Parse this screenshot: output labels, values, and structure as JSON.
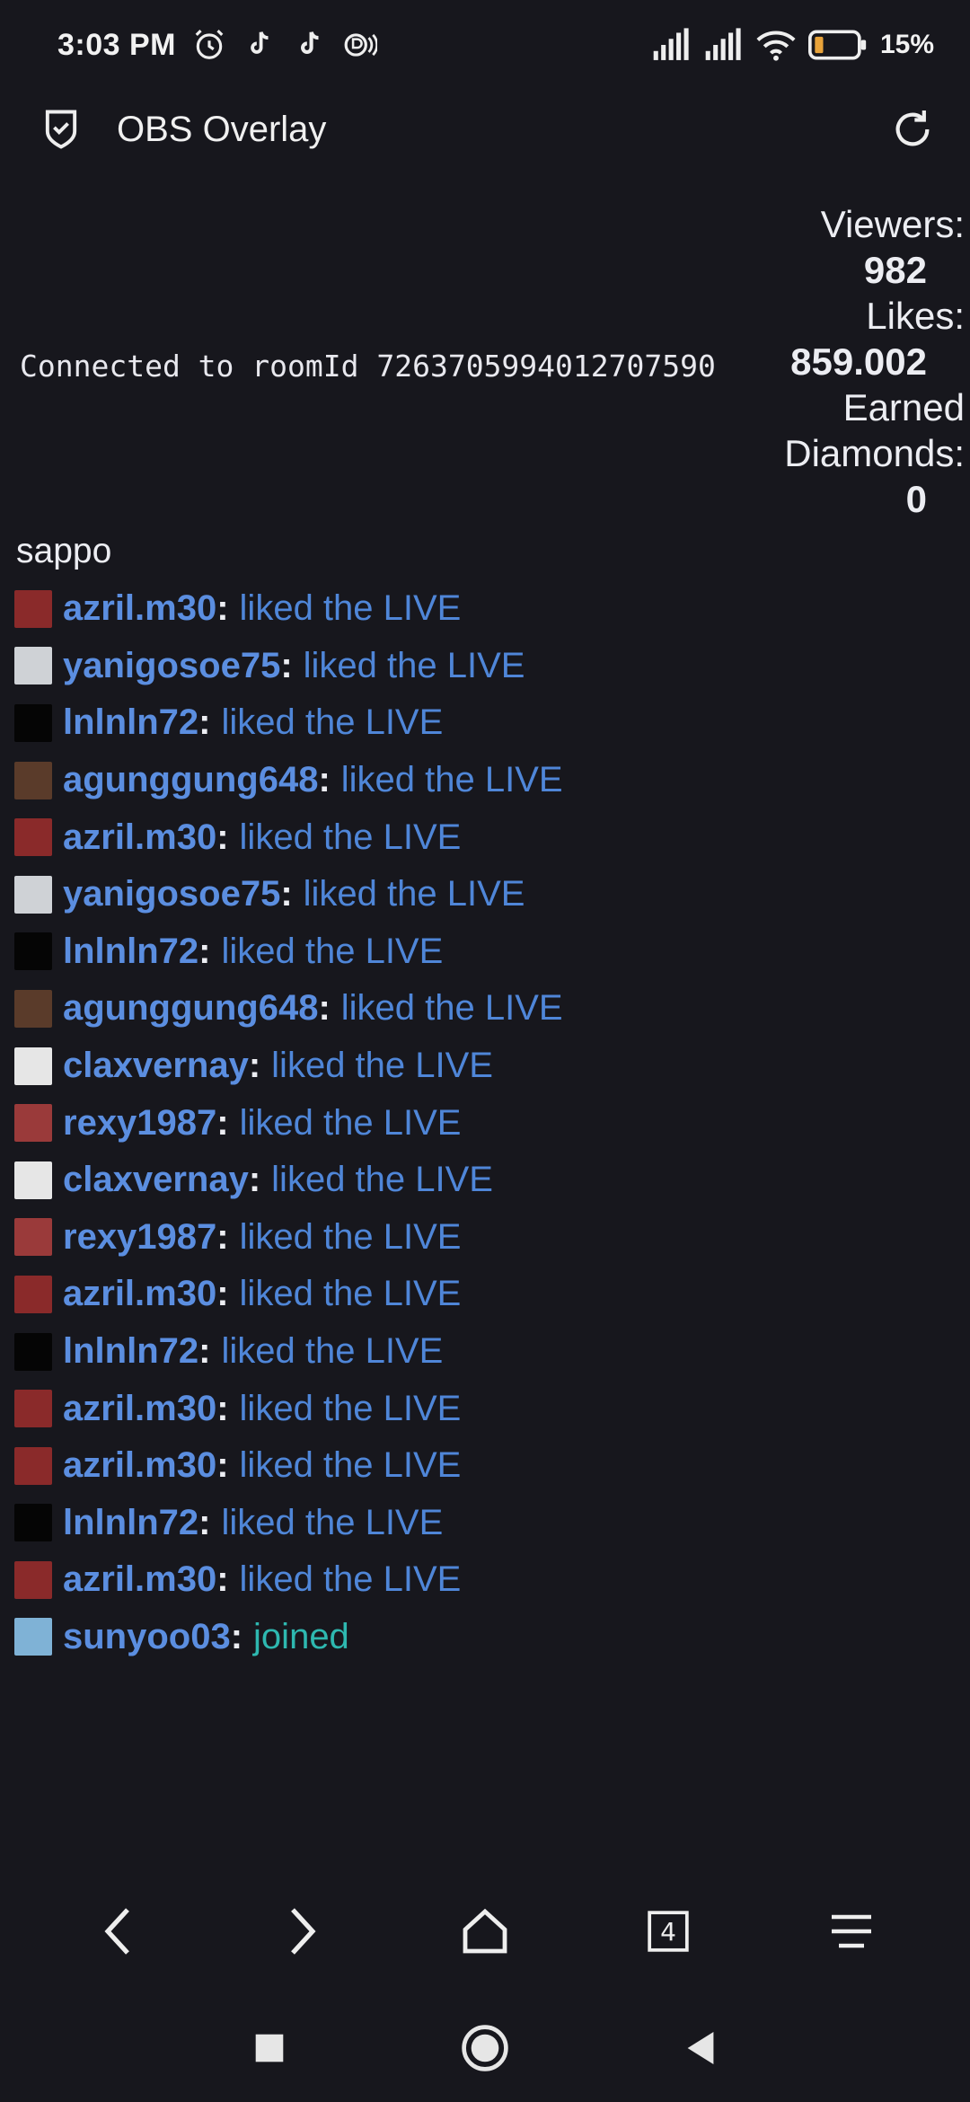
{
  "status_bar": {
    "time": "3:03 PM",
    "battery_percent": "15%",
    "icons": [
      "alarm-icon",
      "tiktok-icon",
      "tiktok-icon",
      "cast-icon",
      "signal-icon",
      "signal-icon",
      "wifi-icon",
      "battery-icon"
    ]
  },
  "app_bar": {
    "title": "OBS Overlay",
    "icons": [
      "shield-icon",
      "refresh-icon"
    ]
  },
  "connection": {
    "text": "Connected to roomId 7263705994012707590"
  },
  "stats": {
    "viewers_label": "Viewers:",
    "viewers_value": "982",
    "likes_label": "Likes:",
    "likes_value": "859.002",
    "diamonds_label_1": "Earned",
    "diamonds_label_2": "Diamonds:",
    "diamonds_value": "0"
  },
  "user": {
    "name": "sappo"
  },
  "feed": [
    {
      "user": "azril.m30",
      "action": "liked the LIVE",
      "type": "like",
      "avatar": "#8a2a2a"
    },
    {
      "user": "yanigosoe75",
      "action": "liked the LIVE",
      "type": "like",
      "avatar": "#cfd2d6"
    },
    {
      "user": "lnlnln72",
      "action": "liked the LIVE",
      "type": "like",
      "avatar": "#050505"
    },
    {
      "user": "agunggung648",
      "action": "liked the LIVE",
      "type": "like",
      "avatar": "#5a3b2a"
    },
    {
      "user": "azril.m30",
      "action": "liked the LIVE",
      "type": "like",
      "avatar": "#8a2a2a"
    },
    {
      "user": "yanigosoe75",
      "action": "liked the LIVE",
      "type": "like",
      "avatar": "#cfd2d6"
    },
    {
      "user": "lnlnln72",
      "action": "liked the LIVE",
      "type": "like",
      "avatar": "#050505"
    },
    {
      "user": "agunggung648",
      "action": "liked the LIVE",
      "type": "like",
      "avatar": "#5a3b2a"
    },
    {
      "user": "claxvernay",
      "action": "liked the LIVE",
      "type": "like",
      "avatar": "#e6e6e6"
    },
    {
      "user": "rexy1987",
      "action": "liked the LIVE",
      "type": "like",
      "avatar": "#9a3a3a"
    },
    {
      "user": "claxvernay",
      "action": "liked the LIVE",
      "type": "like",
      "avatar": "#e6e6e6"
    },
    {
      "user": "rexy1987",
      "action": "liked the LIVE",
      "type": "like",
      "avatar": "#9a3a3a"
    },
    {
      "user": "azril.m30",
      "action": "liked the LIVE",
      "type": "like",
      "avatar": "#8a2a2a"
    },
    {
      "user": "lnlnln72",
      "action": "liked the LIVE",
      "type": "like",
      "avatar": "#050505"
    },
    {
      "user": "azril.m30",
      "action": "liked the LIVE",
      "type": "like",
      "avatar": "#8a2a2a"
    },
    {
      "user": "azril.m30",
      "action": "liked the LIVE",
      "type": "like",
      "avatar": "#8a2a2a"
    },
    {
      "user": "lnlnln72",
      "action": "liked the LIVE",
      "type": "like",
      "avatar": "#050505"
    },
    {
      "user": "azril.m30",
      "action": "liked the LIVE",
      "type": "like",
      "avatar": "#8a2a2a"
    },
    {
      "user": "sunyoo03",
      "action": "joined",
      "type": "join",
      "avatar": "#7fb2d6"
    }
  ],
  "browser_bar": {
    "tab_count": "4",
    "icons": [
      "back-icon",
      "forward-icon",
      "home-icon",
      "tabs-icon",
      "menu-icon"
    ]
  },
  "colors": {
    "background": "#17171d",
    "username": "#5b8ee0",
    "like_action": "#4f86d8",
    "join_action": "#2eb8b0"
  }
}
